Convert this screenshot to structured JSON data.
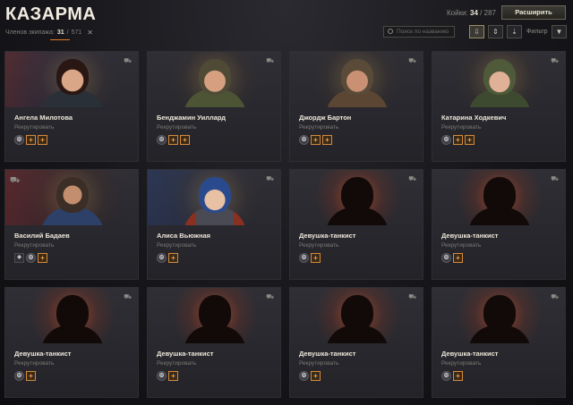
{
  "header": {
    "title": "КАЗАРМА",
    "bunks_label": "Койки:",
    "bunks_current": "34",
    "bunks_total": "287",
    "expand_label": "Расширить"
  },
  "toolbar": {
    "crew_label": "Членов экипажа:",
    "crew_current": "31",
    "crew_total": "571",
    "search_placeholder": "Поиск по названию",
    "filter_label": "Фильтр"
  },
  "colors": {
    "accent": "#e07a2a",
    "skill_border": "#d68a3a",
    "background": "#16161a"
  },
  "cards": [
    {
      "name": "Ангела Милотова",
      "recruit": "Рекрутировать",
      "skills": [
        "gear-icon",
        "plus",
        "plus"
      ]
    },
    {
      "name": "Бенджамин Уиллард",
      "recruit": "Рекрутировать",
      "skills": [
        "gear-icon",
        "plus",
        "plus"
      ]
    },
    {
      "name": "Джордж Бартон",
      "recruit": "Рекрутировать",
      "skills": [
        "gear-icon",
        "plus",
        "plus"
      ]
    },
    {
      "name": "Катарина Ходкевич",
      "recruit": "Рекрутировать",
      "skills": [
        "gear-icon",
        "plus",
        "plus"
      ]
    },
    {
      "name": "Василий Бадаев",
      "recruit": "Рекрутировать",
      "skills": [
        "perk-icon",
        "gear-icon",
        "plus"
      ]
    },
    {
      "name": "Алиса Вьюжная",
      "recruit": "Рекрутировать",
      "skills": [
        "gear-icon",
        "plus"
      ]
    },
    {
      "name": "Девушка-танкист",
      "recruit": "Рекрутировать",
      "skills": [
        "gear-icon",
        "plus"
      ]
    },
    {
      "name": "Девушка-танкист",
      "recruit": "Рекрутировать",
      "skills": [
        "gear-icon",
        "plus"
      ]
    },
    {
      "name": "Девушка-танкист",
      "recruit": "Рекрутировать",
      "skills": [
        "gear-icon",
        "plus"
      ]
    },
    {
      "name": "Девушка-танкист",
      "recruit": "Рекрутировать",
      "skills": [
        "gear-icon",
        "plus"
      ]
    },
    {
      "name": "Девушка-танкист",
      "recruit": "Рекрутировать",
      "skills": [
        "gear-icon",
        "plus"
      ]
    },
    {
      "name": "Девушка-танкист",
      "recruit": "Рекрутировать",
      "skills": [
        "gear-icon",
        "plus"
      ]
    }
  ]
}
